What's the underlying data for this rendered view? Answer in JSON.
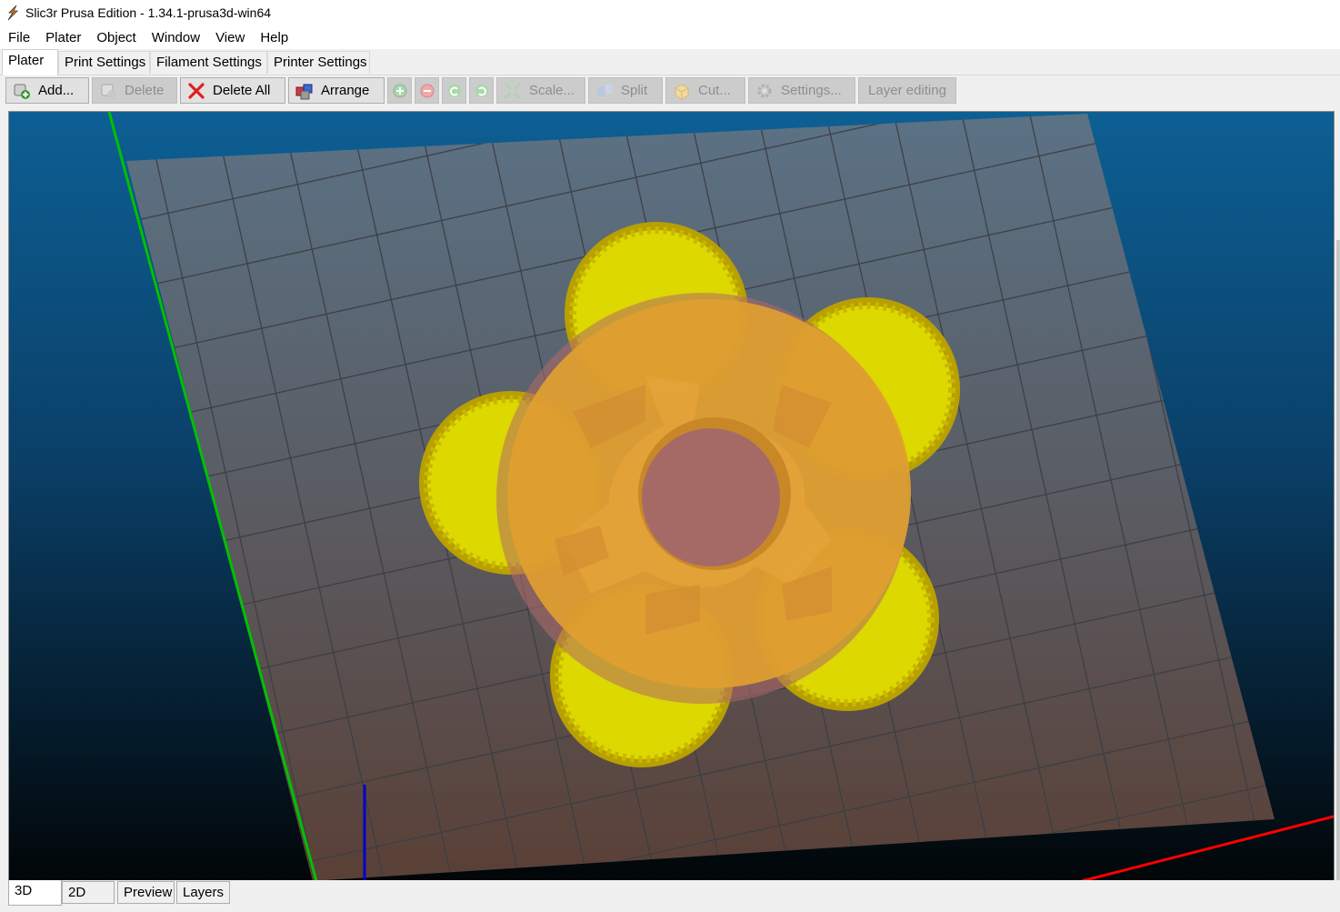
{
  "window": {
    "title": "Slic3r Prusa Edition - 1.34.1-prusa3d-win64",
    "icon": "slic3r-logo-icon"
  },
  "menu": [
    "File",
    "Plater",
    "Object",
    "Window",
    "View",
    "Help"
  ],
  "tabs": [
    {
      "label": "Plater",
      "active": true
    },
    {
      "label": "Print Settings",
      "active": false
    },
    {
      "label": "Filament Settings",
      "active": false
    },
    {
      "label": "Printer Settings",
      "active": false
    }
  ],
  "toolbar": {
    "add": {
      "label": "Add...",
      "icon": "add-object-icon",
      "enabled": true
    },
    "delete": {
      "label": "Delete",
      "icon": "delete-object-icon",
      "enabled": false
    },
    "delete_all": {
      "label": "Delete All",
      "icon": "delete-all-x-icon",
      "enabled": true
    },
    "arrange": {
      "label": "Arrange",
      "icon": "arrange-icon",
      "enabled": true
    },
    "increase": {
      "icon": "plus-circle-icon",
      "enabled": false
    },
    "decrease": {
      "icon": "minus-circle-icon",
      "enabled": false
    },
    "rotate_ccw": {
      "icon": "rotate-ccw-icon",
      "enabled": false
    },
    "rotate_cw": {
      "icon": "rotate-cw-icon",
      "enabled": false
    },
    "scale": {
      "label": "Scale...",
      "icon": "scale-arrows-icon",
      "enabled": false
    },
    "split": {
      "label": "Split",
      "icon": "split-icon",
      "enabled": false
    },
    "cut": {
      "label": "Cut...",
      "icon": "cut-box-icon",
      "enabled": false
    },
    "settings": {
      "label": "Settings...",
      "icon": "gear-icon",
      "enabled": false
    },
    "layer_editing": {
      "label": "Layer editing",
      "enabled": false
    }
  },
  "view_tabs": [
    {
      "label": "3D",
      "active": true
    },
    {
      "label": "2D",
      "active": false
    },
    {
      "label": "Preview",
      "active": false
    },
    {
      "label": "Layers",
      "active": false
    }
  ],
  "scene": {
    "object": "fidget-spinner",
    "colors": {
      "object_body": "#e0a030",
      "bearing_pockets": "#dcd800",
      "base_disc": "#b36a6a",
      "bed": "#5b6670",
      "x_axis": "#ff0000",
      "y_axis": "#00cc00",
      "z_axis": "#0000cc"
    }
  }
}
